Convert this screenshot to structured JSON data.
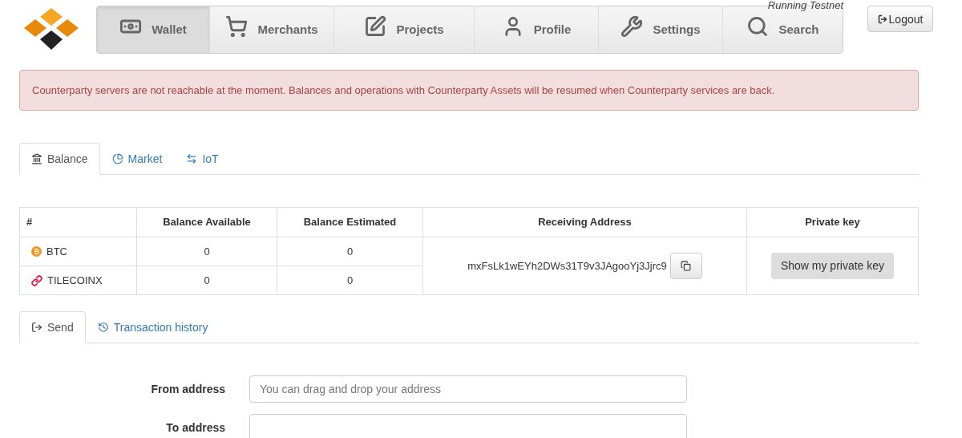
{
  "header": {
    "status_text": "Running Testnet",
    "nav": [
      {
        "label": "Wallet",
        "selected": true
      },
      {
        "label": "Merchants",
        "selected": false
      },
      {
        "label": "Projects",
        "selected": false
      },
      {
        "label": "Profile",
        "selected": false
      },
      {
        "label": "Settings",
        "selected": false
      },
      {
        "label": "Search",
        "selected": false
      }
    ],
    "logout": "Logout"
  },
  "alert": "Counterparty servers are not reachable at the moment. Balances and operations with Counterparty Assets will be resumed when Counterparty services are back.",
  "tabs": [
    {
      "label": "Balance",
      "selected": true
    },
    {
      "label": "Market",
      "selected": false
    },
    {
      "label": "IoT",
      "selected": false
    }
  ],
  "table": {
    "columns": [
      "#",
      "Balance Available",
      "Balance Estimated",
      "Receiving Address",
      "Private key"
    ],
    "rows": [
      {
        "asset": "BTC",
        "kind": "btc",
        "available": "0",
        "estimated": "0"
      },
      {
        "asset": "TILECOINX",
        "kind": "tile",
        "available": "0",
        "estimated": "0"
      }
    ],
    "address": "mxFsLk1wEYh2DWs31T9v3JAgooYj3Jjrc9",
    "private_key_button": "Show my private key"
  },
  "send_tabs": [
    {
      "label": "Send",
      "selected": true
    },
    {
      "label": "Transaction history",
      "selected": false
    }
  ],
  "form": [
    {
      "label": "From address",
      "placeholder": "You can drag and drop your address"
    },
    {
      "label": "To address"
    }
  ]
}
